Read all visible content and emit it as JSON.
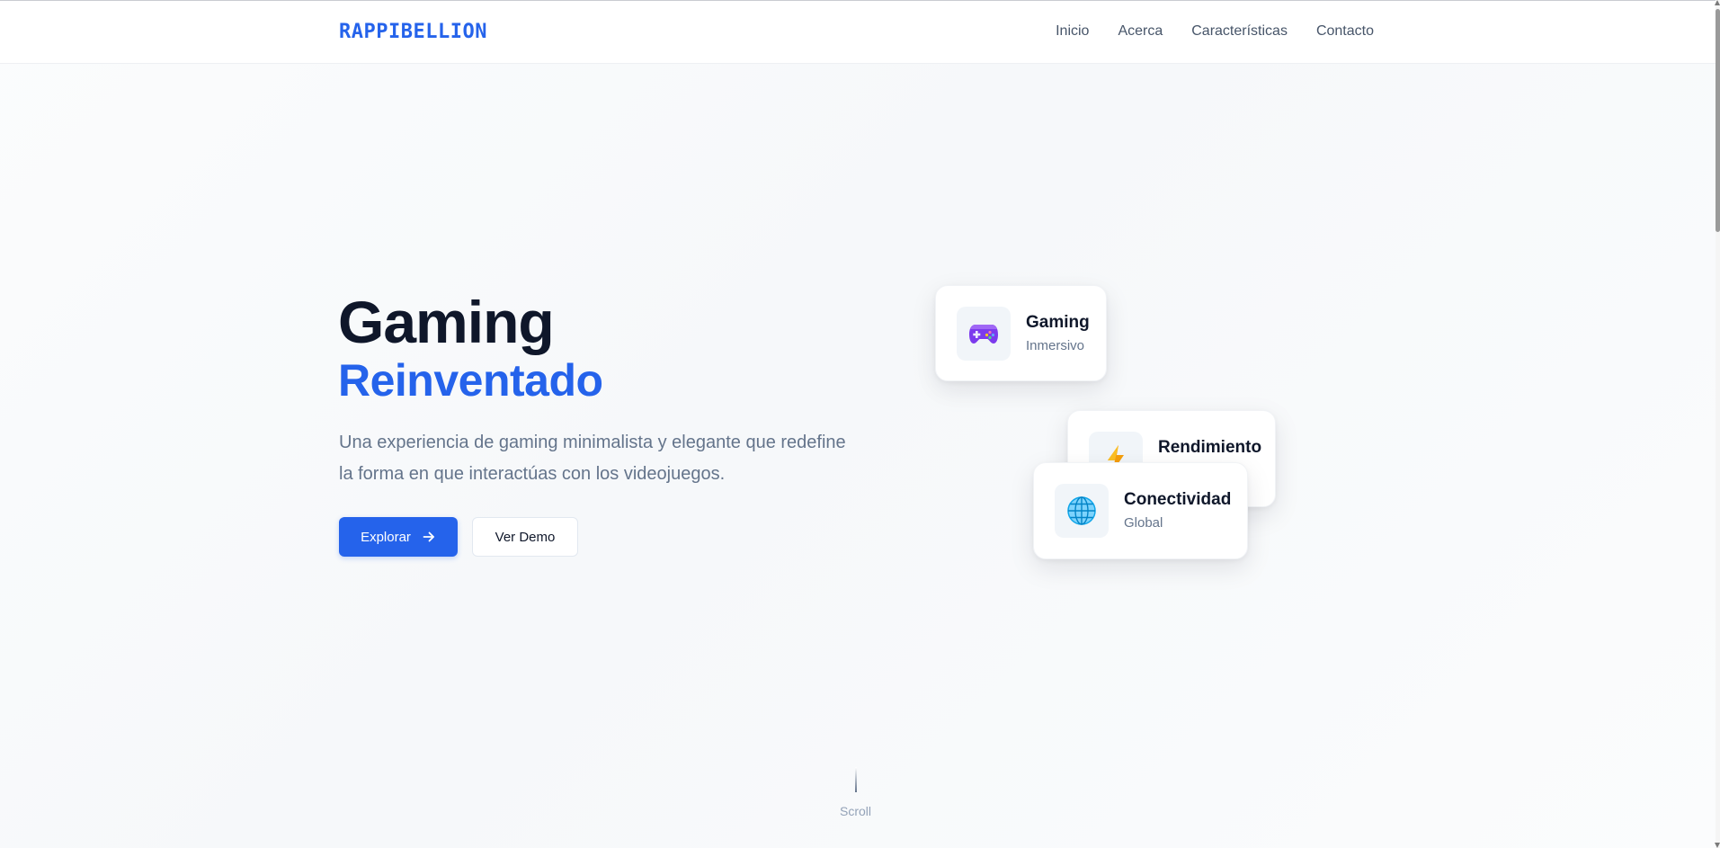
{
  "brand": {
    "logo": "RAPPIBELLION",
    "accent_color": "#2563eb"
  },
  "nav": {
    "links": [
      {
        "label": "Inicio"
      },
      {
        "label": "Acerca"
      },
      {
        "label": "Características"
      },
      {
        "label": "Contacto"
      }
    ]
  },
  "hero": {
    "title_line1": "Gaming",
    "title_line2": "Reinventado",
    "description": "Una experiencia de gaming minimalista y elegante que redefine la forma en que interactúas con los videojuegos.",
    "primary_button": "Explorar",
    "secondary_button": "Ver Demo"
  },
  "cards": [
    {
      "icon": "gamepad-icon",
      "title": "Gaming",
      "subtitle": "Inmersivo"
    },
    {
      "icon": "lightning-icon",
      "title": "Rendimiento",
      "subtitle": ""
    },
    {
      "icon": "globe-icon",
      "title": "Conectividad",
      "subtitle": "Global"
    }
  ],
  "scroll_indicator": {
    "label": "Scroll"
  }
}
